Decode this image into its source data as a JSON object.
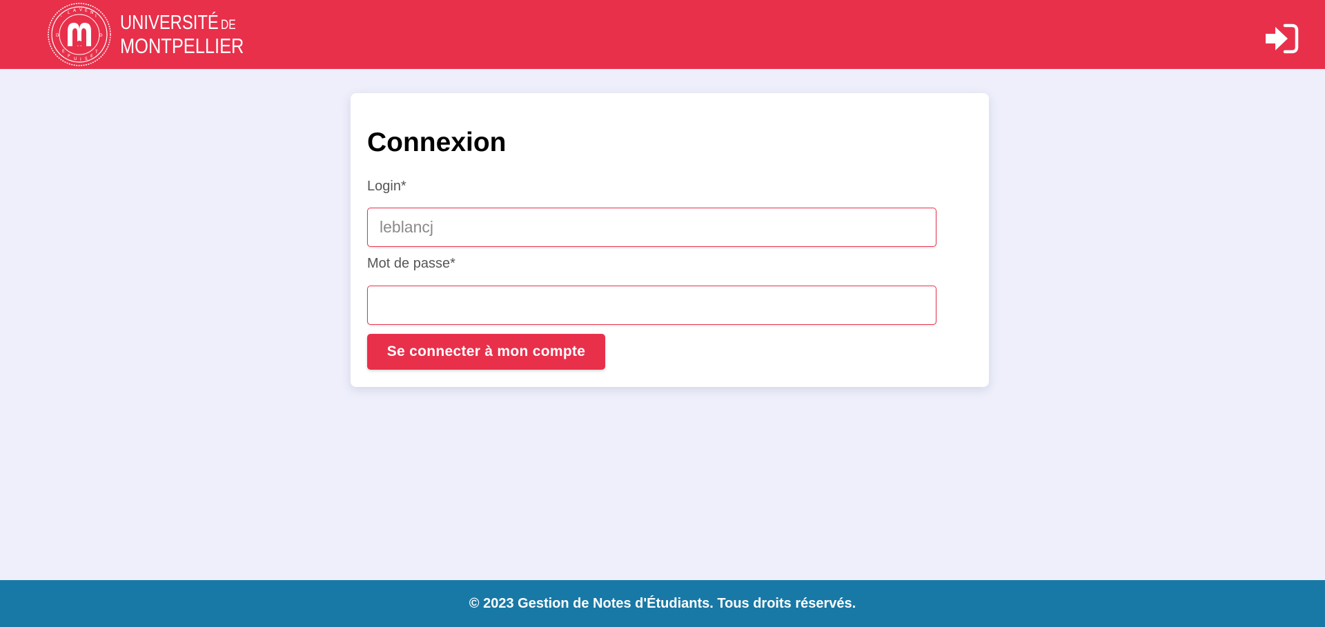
{
  "colors": {
    "brand_red": "#e8304b",
    "background": "#eeeffb",
    "footer_blue": "#1879a6",
    "card": "#ffffff"
  },
  "header": {
    "logo": {
      "line1": "UNIVERSITÉ",
      "line1_suffix": "DE",
      "line2": "MONTPELLIER",
      "seal_icon": "university-seal-icon"
    },
    "login_icon": "sign-in-icon"
  },
  "login_form": {
    "title": "Connexion",
    "login_label": "Login*",
    "login_value": "",
    "login_placeholder": "leblancj",
    "password_label": "Mot de passe*",
    "password_value": "",
    "submit_label": "Se connecter à mon compte"
  },
  "footer": {
    "text": "© 2023 Gestion de Notes d'Étudiants. Tous droits réservés."
  }
}
